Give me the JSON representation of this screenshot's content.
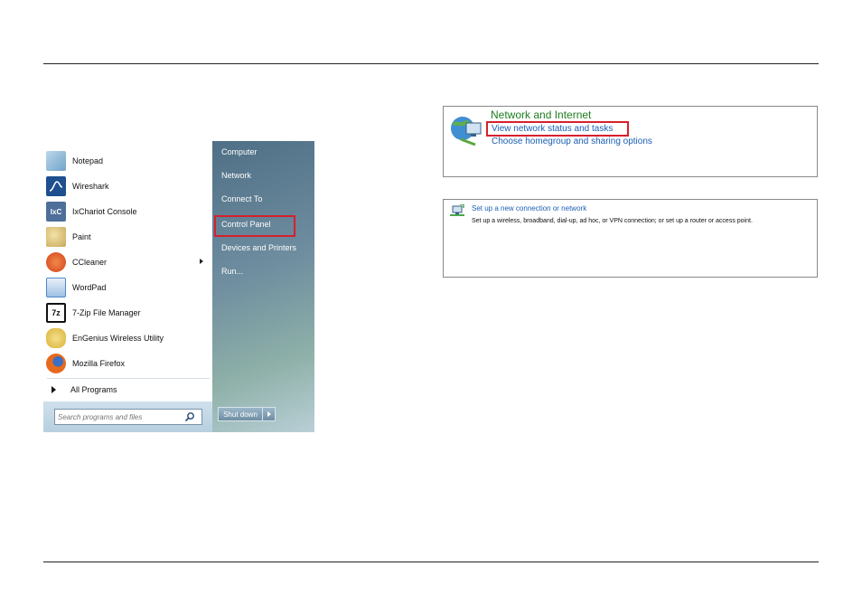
{
  "start_menu": {
    "programs": [
      {
        "label": "Notepad",
        "icon": "notepad-icon",
        "color": "#6fa4c9"
      },
      {
        "label": "Wireshark",
        "icon": "wireshark-icon",
        "color": "#1e4f8f"
      },
      {
        "label": "IxChariot Console",
        "icon": "ixchariot-icon",
        "color": "#4d6f9a"
      },
      {
        "label": "Paint",
        "icon": "paint-icon",
        "color": "#c8a85a"
      },
      {
        "label": "CCleaner",
        "icon": "ccleaner-icon",
        "color": "#d4401c",
        "submenu": true
      },
      {
        "label": "WordPad",
        "icon": "wordpad-icon",
        "color": "#4f88c6"
      },
      {
        "label": "7-Zip File Manager",
        "icon": "7zip-icon",
        "color": "#111111"
      },
      {
        "label": "EnGenius Wireless Utility",
        "icon": "engenius-icon",
        "color": "#d9b23a"
      },
      {
        "label": "Mozilla Firefox",
        "icon": "firefox-icon",
        "color": "#e56a1c"
      }
    ],
    "icon_glyphs": {
      "ixchariot": "IxC",
      "sevenzip": "7z"
    },
    "all_programs_label": "All Programs",
    "search_placeholder": "Search programs and files",
    "right_items": [
      "Computer",
      "Network",
      "Connect To",
      "Control Panel",
      "Devices and Printers",
      "Run..."
    ],
    "highlighted_item": "Control Panel",
    "shutdown_label": "Shut down"
  },
  "network_panel": {
    "title": "Network and Internet",
    "link_status": "View network status and tasks",
    "link_homegroup": "Choose homegroup and sharing options"
  },
  "connection_panel": {
    "link": "Set up a new connection or network",
    "description": "Set up a wireless, broadband, dial-up, ad hoc, or VPN connection; or set up a router or access point."
  },
  "colors": {
    "highlight": "#d6202c",
    "link": "#1a5fb4",
    "category_title": "#1e7e1e"
  }
}
